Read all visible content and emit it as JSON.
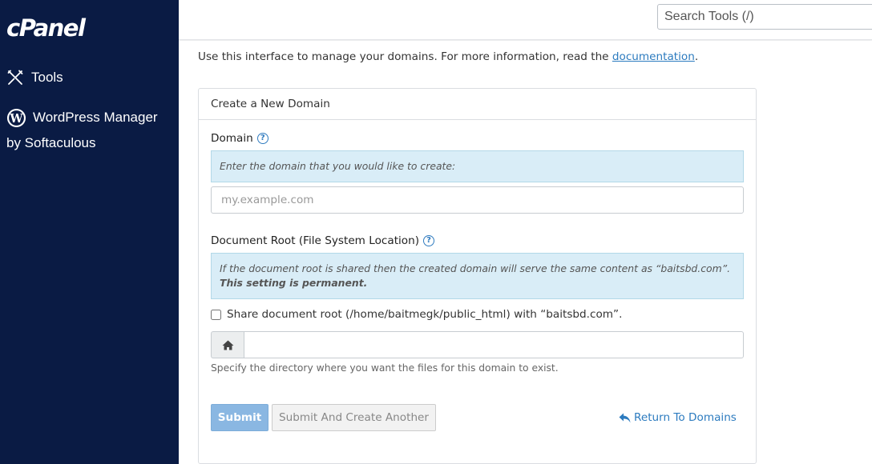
{
  "sidebar": {
    "logo": "cPanel",
    "items": [
      {
        "label": "Tools",
        "icon": "tools-icon"
      },
      {
        "label": "WordPress Manager",
        "sublabel": "by Softaculous",
        "icon": "wordpress-icon"
      }
    ]
  },
  "topbar": {
    "search_placeholder": "Search Tools (/)"
  },
  "main": {
    "intro_text": "Use this interface to manage your domains. For more information, read the ",
    "intro_link": "documentation",
    "intro_end": "."
  },
  "panel": {
    "title": "Create a New Domain",
    "domain": {
      "label": "Domain",
      "help_icon": "?",
      "info": "Enter the domain that you would like to create:",
      "placeholder": "my.example.com",
      "value": ""
    },
    "docroot": {
      "label": "Document Root (File System Location)",
      "help_icon": "?",
      "info_text": "If the document root is shared then the created domain will serve the same content as “baitsbd.com”. ",
      "info_bold": "This setting is permanent.",
      "share_checkbox_label": "Share document root (/home/baitmegk/public_html) with “baitsbd.com”.",
      "share_checked": false,
      "addon_icon": "home-icon",
      "value": "",
      "help_text": "Specify the directory where you want the files for this domain to exist."
    },
    "buttons": {
      "submit": "Submit",
      "submit_another": "Submit And Create Another",
      "return": "Return To Domains"
    }
  },
  "colors": {
    "sidebar_bg": "#0a1b44",
    "link": "#2c7bbf",
    "info_bg": "#d9edf7",
    "submit_bg": "#8ab7e2"
  }
}
